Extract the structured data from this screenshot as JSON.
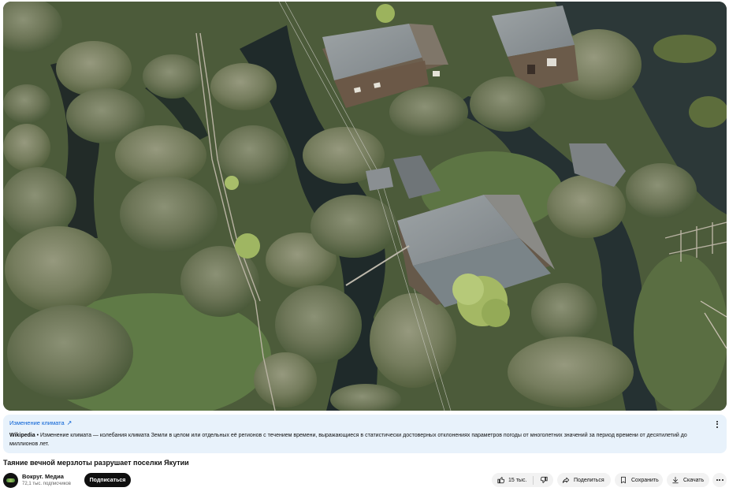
{
  "video": {
    "scene": "aerial-permafrost-village"
  },
  "info_panel": {
    "topic_link": "Изменение климата",
    "source": "Wikipedia",
    "description": " • Изменение климата — колебания климата Земли в целом или отдельных её регионов с течением времени, выражающиеся в статистически достоверных отклонениях параметров погоды от многолетних значений за период времени от десятилетий до миллионов лет."
  },
  "video_title": "Таяние вечной мерзлоты разрушает поселки Якутии",
  "channel": {
    "name": "Вокруг. Медиа",
    "subscribers": "72,1 тыс. подписчиков"
  },
  "actions": {
    "subscribe_label": "Подписаться",
    "likes": "15 тыс.",
    "share_label": "Поделиться",
    "save_label": "Сохранить",
    "download_label": "Скачать"
  },
  "icons": {
    "topic": "external-link-icon",
    "like": "thumbs-up-icon",
    "dislike": "thumbs-down-icon",
    "share": "share-arrow-icon",
    "save": "bookmark-icon",
    "download": "download-icon",
    "more": "more-dots-icon"
  }
}
